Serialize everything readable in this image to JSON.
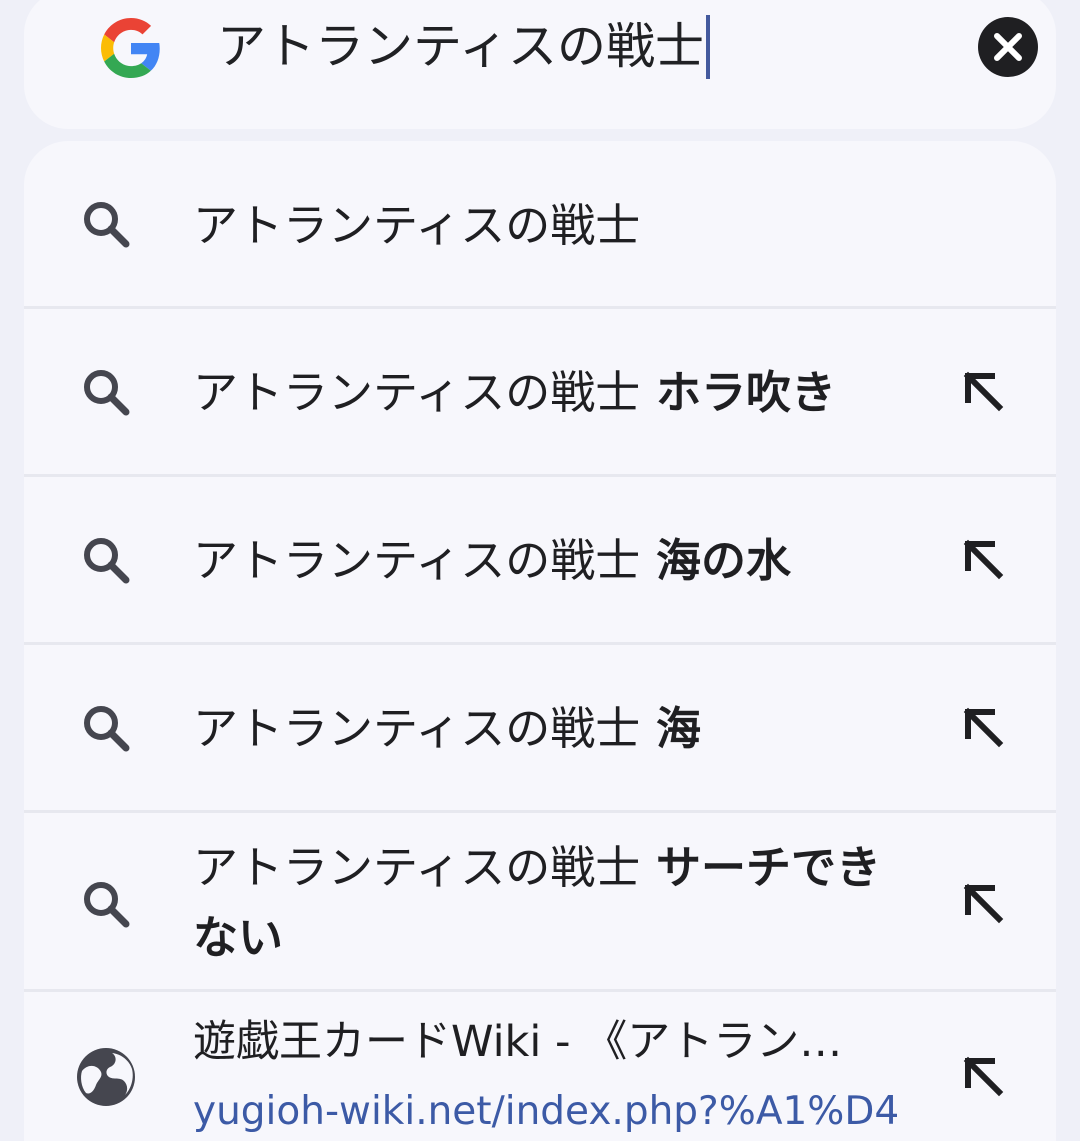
{
  "search_bar": {
    "query": "アトランティスの戦士",
    "logo": "google-g-logo",
    "clear_icon": "close-icon"
  },
  "suggestions": [
    {
      "type": "query",
      "typed": "アトランティスの戦士",
      "suffix": "",
      "icon": "search-icon"
    },
    {
      "type": "query",
      "typed": "アトランティスの戦士",
      "suffix": " ホラ吹き",
      "icon": "search-icon",
      "action_icon": "arrow-up-left-icon"
    },
    {
      "type": "query",
      "typed": "アトランティスの戦士",
      "suffix": " 海の水",
      "icon": "search-icon",
      "action_icon": "arrow-up-left-icon"
    },
    {
      "type": "query",
      "typed": "アトランティスの戦士",
      "suffix": " 海",
      "icon": "search-icon",
      "action_icon": "arrow-up-left-icon"
    },
    {
      "type": "query",
      "typed": "アトランティスの戦士",
      "suffix": " サーチできない",
      "icon": "search-icon",
      "action_icon": "arrow-up-left-icon"
    }
  ],
  "site_suggestion": {
    "title": "遊戯王カードWiki - 《アトラン…",
    "url": "yugioh-wiki.net/index.php?%A1%D4",
    "icon": "globe-icon",
    "action_icon": "arrow-up-left-icon"
  },
  "colors": {
    "background": "#eff0f8",
    "card": "#f7f7fc",
    "caret": "#445a9e",
    "url": "#3c5aa6"
  }
}
